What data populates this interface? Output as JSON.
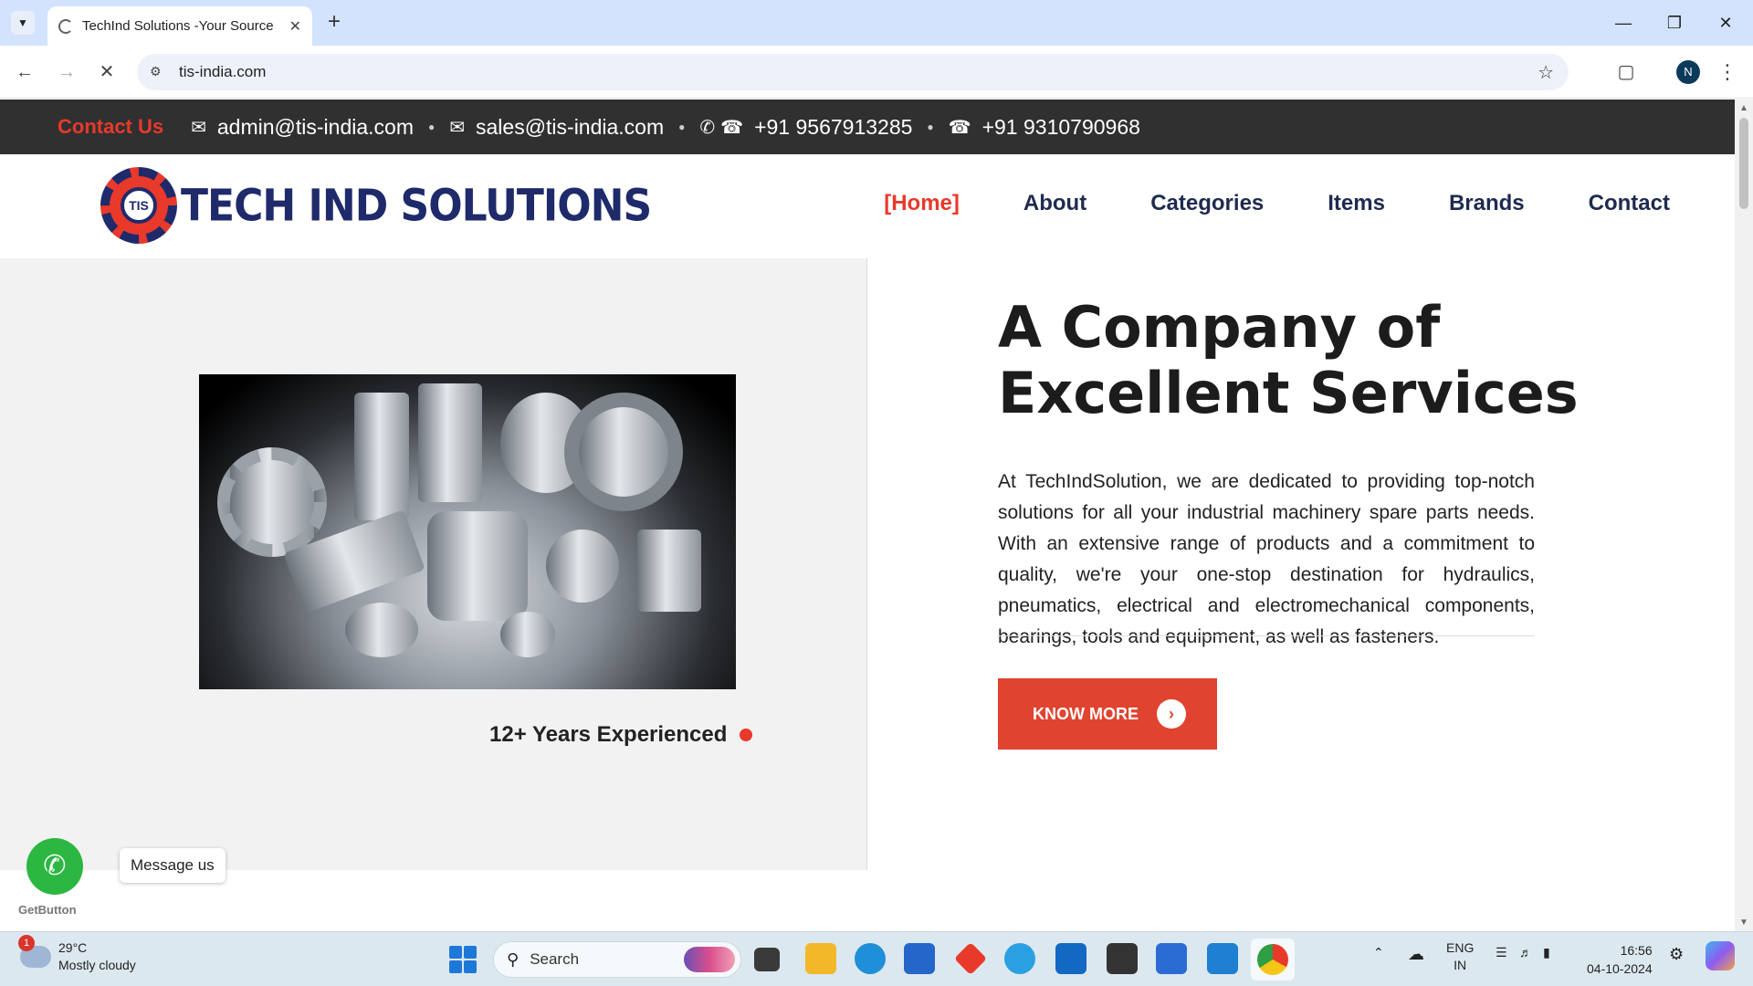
{
  "browser": {
    "tab_title": "TechInd Solutions -Your Source",
    "url": "tis-india.com"
  },
  "topbar": {
    "contact_label": "Contact Us",
    "email1": "admin@tis-india.com",
    "email2": "sales@tis-india.com",
    "phone1": "+91 9567913285",
    "phone2": "+91 9310790968"
  },
  "logo": {
    "text": "TECH IND SOLUTIONS",
    "mark": "TIS"
  },
  "nav": {
    "home": "[Home]",
    "about": "About",
    "categories": "Categories",
    "items": "Items",
    "brands": "Brands",
    "contact": "Contact"
  },
  "hero": {
    "title_line1": "A Company of",
    "title_line2": "Excellent Services",
    "text": "At TechIndSolution, we are dedicated to providing top-notch solutions for all your industrial machinery spare parts needs. With an extensive range of products and a commitment to quality, we're your one-stop destination for hydraulics, pneumatics, electrical and electromechanical components, bearings, tools and equipment, as well as fasteners.",
    "years_label": "12+ Years Experienced",
    "button_label": "KNOW MORE"
  },
  "widget": {
    "message_label": "Message us",
    "brand_label": "GetButton"
  },
  "taskbar": {
    "weather_badge": "1",
    "temperature": "29°C",
    "condition": "Mostly cloudy",
    "search_label": "Search",
    "lang_line1": "ENG",
    "lang_line2": "IN",
    "time": "16:56",
    "date": "04-10-2024"
  },
  "colors": {
    "accent": "#e8392b",
    "navy": "#1f2a6b",
    "topbar_bg": "#303030"
  }
}
